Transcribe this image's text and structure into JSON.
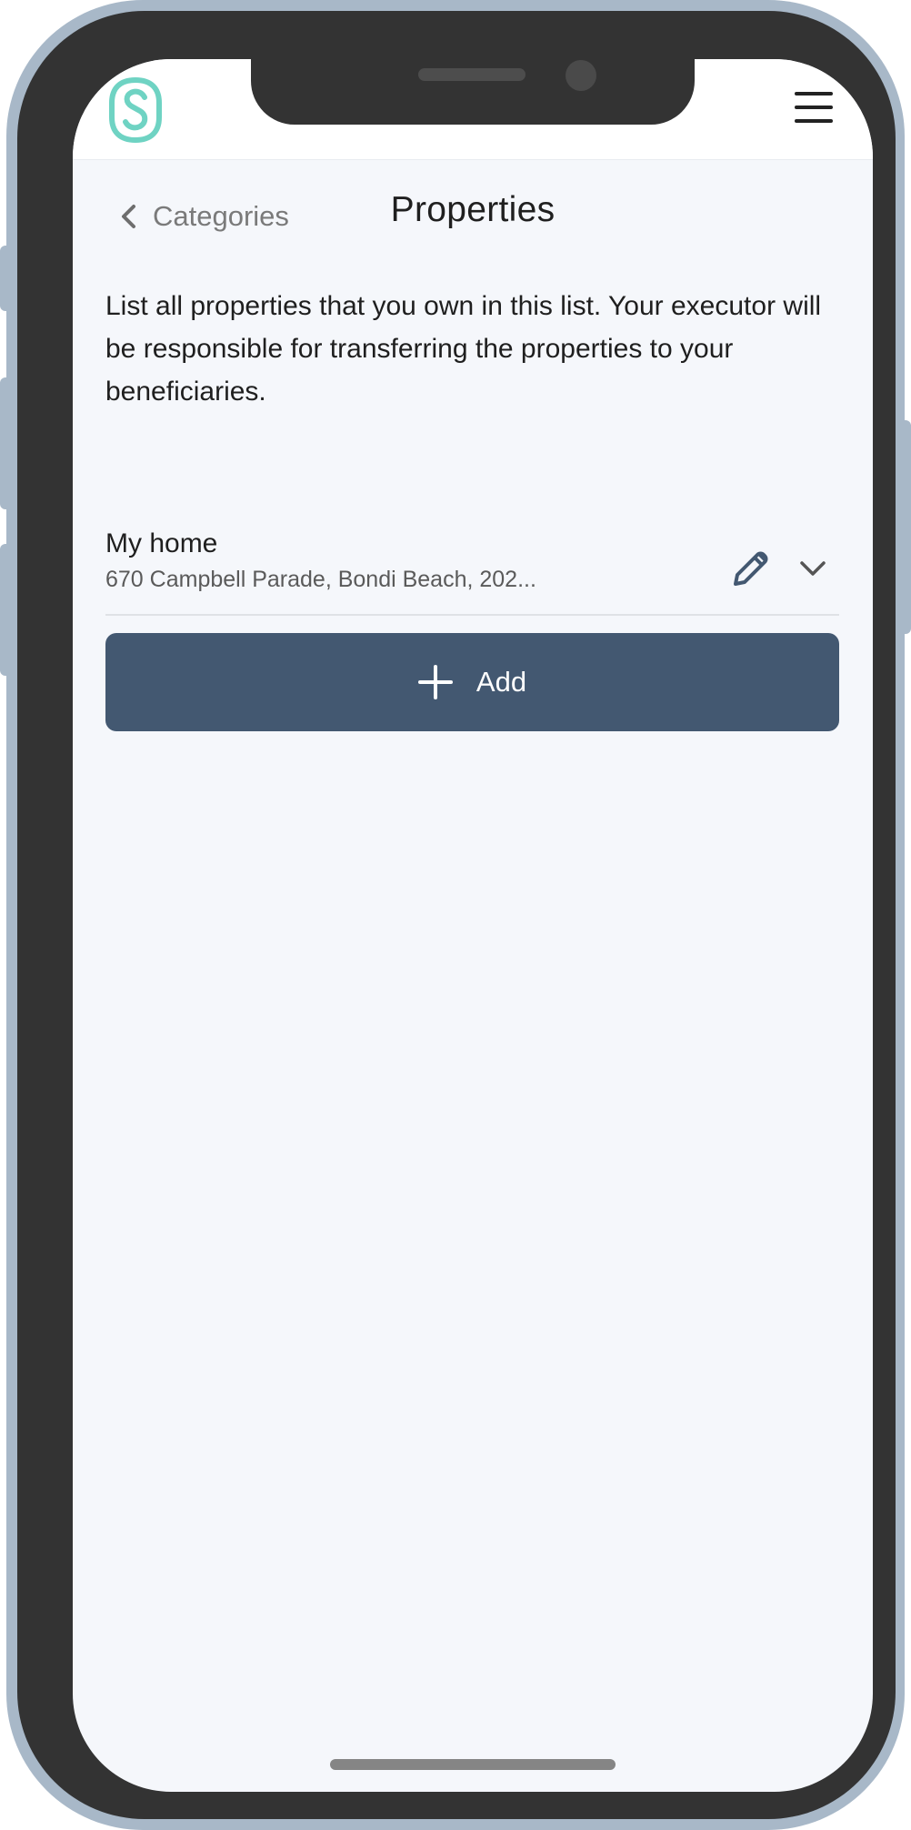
{
  "header": {
    "logo_icon": "shield-s-logo-icon",
    "menu_icon": "hamburger-menu-icon"
  },
  "nav": {
    "back_label": "Categories",
    "back_icon": "chevron-left-icon",
    "title": "Properties"
  },
  "description": "List all properties that you own in this list. Your executor will be responsible for transferring the properties to your beneficiaries.",
  "properties": [
    {
      "name": "My home",
      "address": "670 Campbell Parade, Bondi Beach, 202...",
      "edit_icon": "pencil-icon",
      "expand_icon": "chevron-down-icon"
    }
  ],
  "add_button": {
    "label": "Add",
    "icon": "plus-icon"
  },
  "colors": {
    "accent": "#435871",
    "logo": "#6fd3c3",
    "background": "#f5f7fb",
    "frame": "#a8b8c8"
  }
}
